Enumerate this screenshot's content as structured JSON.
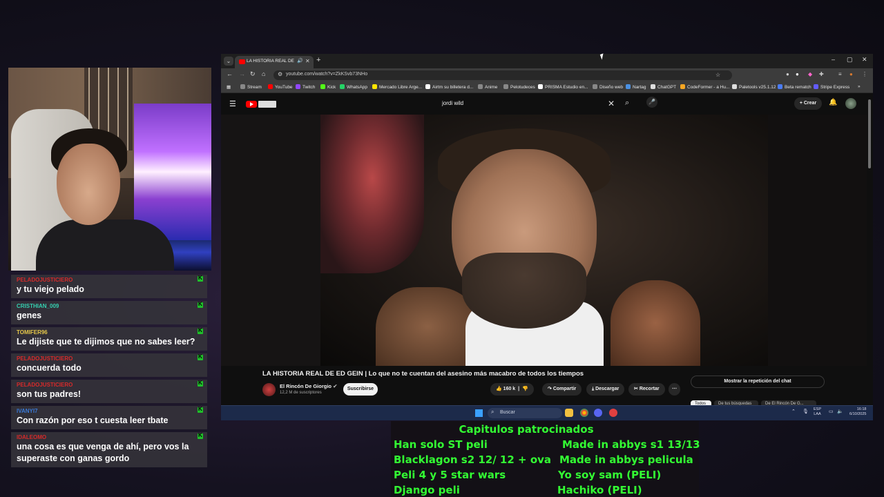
{
  "browser": {
    "tab_title": "LA HISTORIA REAL DE ED G",
    "url": "youtube.com/watch?v=ZkKSvb73NHo",
    "bookmarks": [
      {
        "label": "Stream",
        "color": "#888888"
      },
      {
        "label": "YouTube",
        "color": "#ff0000"
      },
      {
        "label": "Twitch",
        "color": "#9146ff"
      },
      {
        "label": "Kick",
        "color": "#53fc18"
      },
      {
        "label": "WhatsApp",
        "color": "#25d366"
      },
      {
        "label": "Mercado Libre Arge...",
        "color": "#ffe600"
      },
      {
        "label": "Airtm su billetera d...",
        "color": "#ffffff"
      },
      {
        "label": "Anime",
        "color": "#888888"
      },
      {
        "label": "Pelotudeces",
        "color": "#888888"
      },
      {
        "label": "PRISMA Estudio en...",
        "color": "#ffffff"
      },
      {
        "label": "Diseño web",
        "color": "#888888"
      },
      {
        "label": "Nartag",
        "color": "#4a90e2"
      },
      {
        "label": "ChatGPT",
        "color": "#dddddd"
      },
      {
        "label": "CodeFormer - a Hu...",
        "color": "#f5a623"
      },
      {
        "label": "Paletools v25.1.12",
        "color": "#dddddd"
      },
      {
        "label": "Beta rematch",
        "color": "#4a7cf7"
      },
      {
        "label": "Stripe Express",
        "color": "#635bff"
      }
    ]
  },
  "youtube": {
    "search_query": "jordi wild",
    "create_label": "Crear",
    "video_title": "LA HISTORIA REAL DE ED GEIN | Lo que no te cuentan del asesino más macabro de todos los tiempos",
    "channel_name": "El Rincón De Giorgio",
    "channel_subs": "12,2 M de suscriptores",
    "subscribe_label": "Suscribirse",
    "likes": "160 k",
    "share_label": "Compartir",
    "download_label": "Descargar",
    "clip_label": "Recortar",
    "chat_replay_label": "Mostrar la repetición del chat",
    "chips": [
      "Todos",
      "De tus búsquedas",
      "De El Rincón De G..."
    ]
  },
  "chat": [
    {
      "user": "PELADOJUSTICIERO",
      "color": "#d62a2a",
      "text": "y tu viejo pelado"
    },
    {
      "user": "CRISTHIAN_009",
      "color": "#35d0b0",
      "text": "genes"
    },
    {
      "user": "TOMIFER96",
      "color": "#e6c84a",
      "text": "Le dijiste que te dijimos que no sabes leer?"
    },
    {
      "user": "PELADOJUSTICIERO",
      "color": "#d62a2a",
      "text": "concuerda todo"
    },
    {
      "user": "PELADOJUSTICIERO",
      "color": "#d62a2a",
      "text": "son tus padres!"
    },
    {
      "user": "IVANYI7",
      "color": "#3a7ad8",
      "text": "Con razón por eso t cuesta leer tbate"
    },
    {
      "user": "IDALEOMO",
      "color": "#d62a2a",
      "text": "una cosa es que venga de ahí, pero vos la superaste con ganas gordo"
    }
  ],
  "taskbar": {
    "search_placeholder": "Buscar",
    "lang_line1": "ESP",
    "lang_line2": "LAA",
    "time": "16:18",
    "date": "6/10/2025"
  },
  "sponsor": {
    "title": "Capitulos patrocinados",
    "left": [
      "Han solo ST peli",
      "Blacklagon s2 12/ 12 + ova",
      "Peli 4  y 5 star wars",
      "Django peli"
    ],
    "right": [
      "Made in abbys s1 13/13",
      "Made in abbys pelicula",
      "Yo soy sam (PELI)",
      "Hachiko (PELI)"
    ],
    "color": "#33ff33"
  }
}
